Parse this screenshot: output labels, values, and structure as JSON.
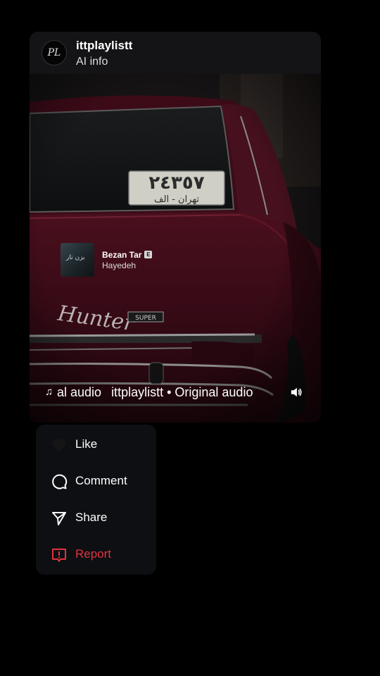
{
  "post": {
    "avatar_text": "PL",
    "username": "ittplaylistt",
    "subtitle": "AI info"
  },
  "media": {
    "plate_number": "٢٤٣٥٧",
    "plate_city": "تهران - الف",
    "car_badge": "Hunter",
    "car_model_badge": "SUPER"
  },
  "music_sticker": {
    "art_text": "بزن تار",
    "title": "Bezan Tar",
    "explicit_label": "E",
    "artist": "Hayedeh"
  },
  "audio": {
    "icon": "music-note-icon",
    "marquee_prefix": "al audio",
    "marquee_text": "ittplaylistt • Original audio",
    "volume_icon": "volume-icon"
  },
  "menu": {
    "items": [
      {
        "label": "Like",
        "icon": "heart-icon"
      },
      {
        "label": "Comment",
        "icon": "comment-icon"
      },
      {
        "label": "Share",
        "icon": "share-icon"
      },
      {
        "label": "Report",
        "icon": "report-icon"
      }
    ]
  },
  "colors": {
    "background": "#000000",
    "header_bg": "#141416",
    "menu_bg": "#0d0f12",
    "car_body": "#3a0b16",
    "report_red": "#e0353f"
  }
}
